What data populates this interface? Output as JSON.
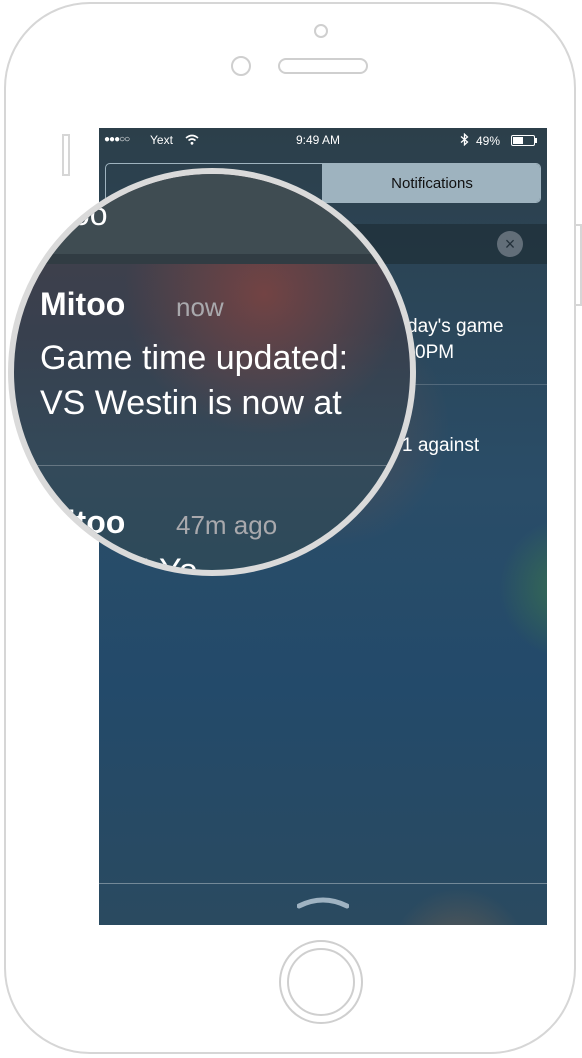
{
  "status_bar": {
    "signal": "●●●○○",
    "carrier": "Yext",
    "time": "9:49 AM",
    "battery_percent": "49%",
    "battery_level": 0.49
  },
  "tabs": {
    "today": "",
    "notifications": "Notifications"
  },
  "app_header": {
    "name": "Mitoo",
    "close_icon": "×"
  },
  "background_notifications": [
    {
      "line1": "day's game",
      "line2": "0PM"
    },
    {
      "line1": "1 against"
    }
  ],
  "magnifier": {
    "header_text": "itoo",
    "notifications": [
      {
        "app": "Mitoo",
        "time": "now",
        "line1": "Game time updated:",
        "line2": "VS Westin is now at"
      },
      {
        "app": "Mitoo",
        "time": "47m ago",
        "line1": "pen! Yo"
      }
    ]
  },
  "colors": {
    "tab_selected": "#9eb3bf",
    "frame": "#d6d6d6"
  }
}
